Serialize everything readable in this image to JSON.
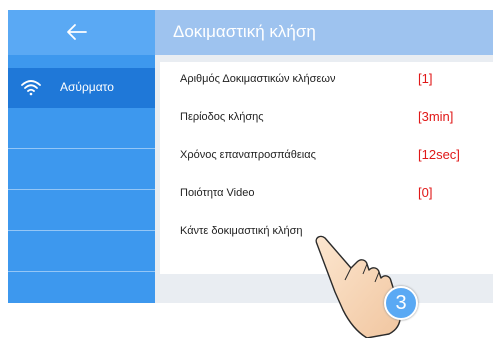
{
  "header": {
    "title": "Δοκιμαστική κλήση"
  },
  "sidebar": {
    "back_icon": "back-arrow-icon",
    "items": [
      {
        "label": "Ασύρματο",
        "icon": "wifi-icon",
        "active": true
      }
    ]
  },
  "settings": [
    {
      "label": "Αριθμός Δοκιμαστικών κλήσεων",
      "value": "[1]"
    },
    {
      "label": "Περίοδος κλήσης",
      "value": "[3min]"
    },
    {
      "label": "Χρόνος επαναπροσπάθειας",
      "value": "[12sec]"
    },
    {
      "label": "Ποιότητα Video",
      "value": "[0]"
    },
    {
      "label": "Κάντε δοκιμαστική κλήση",
      "value": ""
    }
  ],
  "step_badge": "3",
  "colors": {
    "sidebar": "#3d98ee",
    "sidebar_active": "#1f78d8",
    "header": "#9ec3ef",
    "value_red": "#e01818",
    "badge": "#5aa9f4"
  }
}
